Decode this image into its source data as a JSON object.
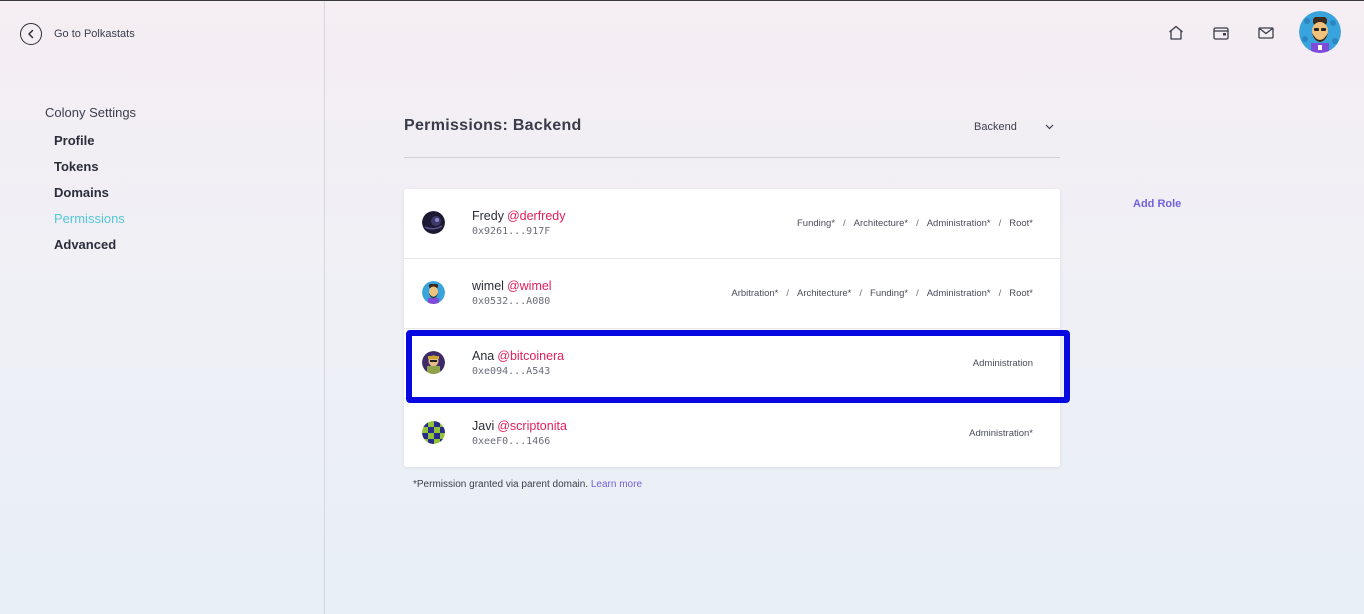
{
  "sidebar": {
    "back_label": "Go to Polkastats",
    "section_title": "Colony Settings",
    "items": [
      {
        "label": "Profile",
        "active": false
      },
      {
        "label": "Tokens",
        "active": false
      },
      {
        "label": "Domains",
        "active": false
      },
      {
        "label": "Permissions",
        "active": true
      },
      {
        "label": "Advanced",
        "active": false
      }
    ]
  },
  "header": {
    "icons": [
      "home-icon",
      "wallet-icon",
      "inbox-icon"
    ],
    "avatar": "user-avatar"
  },
  "main": {
    "title": "Permissions: Backend",
    "domain_select": "Backend",
    "add_role_label": "Add Role",
    "members": [
      {
        "display": "Fredy",
        "username": "@derfredy",
        "address": "0x9261...917F",
        "roles": [
          "Funding*",
          "Architecture*",
          "Administration*",
          "Root*"
        ]
      },
      {
        "display": "wimel",
        "username": "@wimel",
        "address": "0x0532...A080",
        "roles": [
          "Arbitration*",
          "Architecture*",
          "Funding*",
          "Administration*",
          "Root*"
        ]
      },
      {
        "display": "Ana",
        "username": "@bitcoinera",
        "address": "0xe094...A543",
        "roles": [
          "Administration"
        ]
      },
      {
        "display": "Javi",
        "username": "@scriptonita",
        "address": "0xeeF0...1466",
        "roles": [
          "Administration*"
        ]
      }
    ],
    "footnote_text": "*Permission granted via parent domain.",
    "footnote_link": "Learn more"
  },
  "colors": {
    "accent_cyan": "#54c6d9",
    "username_pink": "#e21e5b",
    "link_purple": "#7360d9",
    "highlight_blue": "#0808e0"
  }
}
